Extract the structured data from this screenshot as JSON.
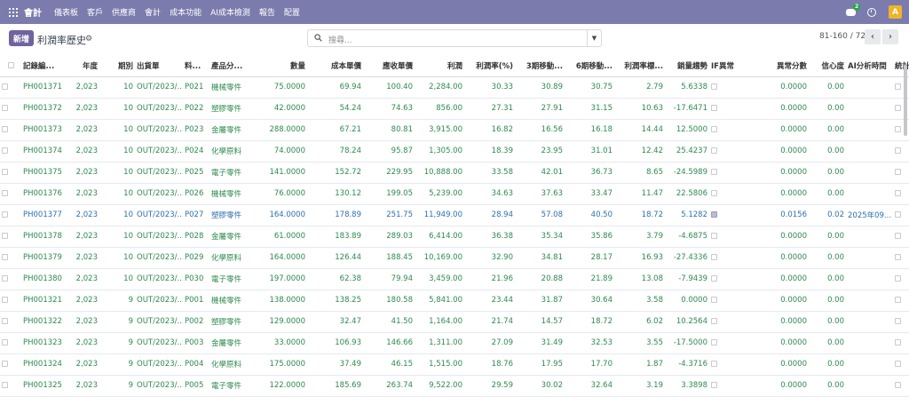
{
  "navbar": {
    "brand": "會計",
    "menu": [
      "儀表板",
      "客戶",
      "供應商",
      "會計",
      "成本功能",
      "AI成本檢測",
      "報告",
      "配置"
    ],
    "chat_badge": "2",
    "avatar_letter": "A"
  },
  "control": {
    "new_label": "新增",
    "title": "利潤率歷史",
    "search_placeholder": "搜尋...",
    "pager_value": "81-160 / 720",
    "prev_label": "‹",
    "next_label": "›"
  },
  "table": {
    "headers": [
      "記錄編...",
      "年度",
      "期別",
      "出貨單",
      "料...",
      "產品分...",
      "數量",
      "成本單價",
      "應收單價",
      "利潤",
      "利潤率(%)",
      "3期移動...",
      "6期移動...",
      "利潤率標...",
      "銷量趨勢",
      "IF異常",
      "異常分數",
      "信心度",
      "AI分析時間",
      "統計"
    ],
    "rows": [
      {
        "id": "PH001371",
        "year": "2,023",
        "period": "10",
        "shipment": "OUT/2023/...",
        "material": "P021",
        "category": "機械零件",
        "qty": "75.0000",
        "cost": "69.94",
        "price": "100.40",
        "profit": "2,284.00",
        "margin": "30.33",
        "ma3": "30.89",
        "ma6": "30.75",
        "std": "2.79",
        "trend": "5.6338",
        "anomaly_score": "0.0000",
        "confidence": "0.00",
        "ai_time": ""
      },
      {
        "id": "PH001372",
        "year": "2,023",
        "period": "10",
        "shipment": "OUT/2023/...",
        "material": "P022",
        "category": "塑膠零件",
        "qty": "42.0000",
        "cost": "54.24",
        "price": "74.63",
        "profit": "856.00",
        "margin": "27.31",
        "ma3": "27.91",
        "ma6": "31.15",
        "std": "10.63",
        "trend": "-17.6471",
        "anomaly_score": "0.0000",
        "confidence": "0.00",
        "ai_time": ""
      },
      {
        "id": "PH001373",
        "year": "2,023",
        "period": "10",
        "shipment": "OUT/2023/...",
        "material": "P023",
        "category": "金屬零件",
        "qty": "288.0000",
        "cost": "67.21",
        "price": "80.81",
        "profit": "3,915.00",
        "margin": "16.82",
        "ma3": "16.56",
        "ma6": "16.18",
        "std": "14.44",
        "trend": "12.5000",
        "anomaly_score": "0.0000",
        "confidence": "0.00",
        "ai_time": ""
      },
      {
        "id": "PH001374",
        "year": "2,023",
        "period": "10",
        "shipment": "OUT/2023/...",
        "material": "P024",
        "category": "化學原料",
        "qty": "74.0000",
        "cost": "78.24",
        "price": "95.87",
        "profit": "1,305.00",
        "margin": "18.39",
        "ma3": "23.95",
        "ma6": "31.01",
        "std": "12.42",
        "trend": "25.4237",
        "anomaly_score": "0.0000",
        "confidence": "0.00",
        "ai_time": ""
      },
      {
        "id": "PH001375",
        "year": "2,023",
        "period": "10",
        "shipment": "OUT/2023/...",
        "material": "P025",
        "category": "電子零件",
        "qty": "141.0000",
        "cost": "152.72",
        "price": "229.95",
        "profit": "10,888.00",
        "margin": "33.58",
        "ma3": "42.01",
        "ma6": "36.73",
        "std": "8.65",
        "trend": "-24.5989",
        "anomaly_score": "0.0000",
        "confidence": "0.00",
        "ai_time": ""
      },
      {
        "id": "PH001376",
        "year": "2,023",
        "period": "10",
        "shipment": "OUT/2023/...",
        "material": "P026",
        "category": "機械零件",
        "qty": "76.0000",
        "cost": "130.12",
        "price": "199.05",
        "profit": "5,239.00",
        "margin": "34.63",
        "ma3": "37.63",
        "ma6": "33.47",
        "std": "11.47",
        "trend": "22.5806",
        "anomaly_score": "0.0000",
        "confidence": "0.00",
        "ai_time": ""
      },
      {
        "id": "PH001377",
        "year": "2,023",
        "period": "10",
        "shipment": "OUT/2023/...",
        "material": "P027",
        "category": "塑膠零件",
        "qty": "164.0000",
        "cost": "178.89",
        "price": "251.75",
        "profit": "11,949.00",
        "margin": "28.94",
        "ma3": "57.08",
        "ma6": "40.50",
        "std": "18.72",
        "trend": "5.1282",
        "anomaly_score": "0.0156",
        "confidence": "0.02",
        "ai_time": "2025年09...",
        "selected": true
      },
      {
        "id": "PH001378",
        "year": "2,023",
        "period": "10",
        "shipment": "OUT/2023/...",
        "material": "P028",
        "category": "金屬零件",
        "qty": "61.0000",
        "cost": "183.89",
        "price": "289.03",
        "profit": "6,414.00",
        "margin": "36.38",
        "ma3": "35.34",
        "ma6": "35.86",
        "std": "3.79",
        "trend": "-4.6875",
        "anomaly_score": "0.0000",
        "confidence": "0.00",
        "ai_time": ""
      },
      {
        "id": "PH001379",
        "year": "2,023",
        "period": "10",
        "shipment": "OUT/2023/...",
        "material": "P029",
        "category": "化學原料",
        "qty": "164.0000",
        "cost": "126.44",
        "price": "188.45",
        "profit": "10,169.00",
        "margin": "32.90",
        "ma3": "34.81",
        "ma6": "28.17",
        "std": "16.93",
        "trend": "-27.4336",
        "anomaly_score": "0.0000",
        "confidence": "0.00",
        "ai_time": ""
      },
      {
        "id": "PH001380",
        "year": "2,023",
        "period": "10",
        "shipment": "OUT/2023/...",
        "material": "P030",
        "category": "電子零件",
        "qty": "197.0000",
        "cost": "62.38",
        "price": "79.94",
        "profit": "3,459.00",
        "margin": "21.96",
        "ma3": "20.88",
        "ma6": "21.89",
        "std": "13.08",
        "trend": "-7.9439",
        "anomaly_score": "0.0000",
        "confidence": "0.00",
        "ai_time": ""
      },
      {
        "id": "PH001321",
        "year": "2,023",
        "period": "9",
        "shipment": "OUT/2023/...",
        "material": "P001",
        "category": "機械零件",
        "qty": "138.0000",
        "cost": "138.25",
        "price": "180.58",
        "profit": "5,841.00",
        "margin": "23.44",
        "ma3": "31.87",
        "ma6": "30.64",
        "std": "3.58",
        "trend": "0.0000",
        "anomaly_score": "0.0000",
        "confidence": "0.00",
        "ai_time": ""
      },
      {
        "id": "PH001322",
        "year": "2,023",
        "period": "9",
        "shipment": "OUT/2023/...",
        "material": "P002",
        "category": "塑膠零件",
        "qty": "129.0000",
        "cost": "32.47",
        "price": "41.50",
        "profit": "1,164.00",
        "margin": "21.74",
        "ma3": "14.57",
        "ma6": "18.72",
        "std": "6.02",
        "trend": "10.2564",
        "anomaly_score": "0.0000",
        "confidence": "0.00",
        "ai_time": ""
      },
      {
        "id": "PH001323",
        "year": "2,023",
        "period": "9",
        "shipment": "OUT/2023/...",
        "material": "P003",
        "category": "金屬零件",
        "qty": "33.0000",
        "cost": "106.93",
        "price": "146.66",
        "profit": "1,311.00",
        "margin": "27.09",
        "ma3": "31.49",
        "ma6": "32.53",
        "std": "3.55",
        "trend": "-17.5000",
        "anomaly_score": "0.0000",
        "confidence": "0.00",
        "ai_time": ""
      },
      {
        "id": "PH001324",
        "year": "2,023",
        "period": "9",
        "shipment": "OUT/2023/...",
        "material": "P004",
        "category": "化學原料",
        "qty": "175.0000",
        "cost": "37.49",
        "price": "46.15",
        "profit": "1,515.00",
        "margin": "18.76",
        "ma3": "17.95",
        "ma6": "17.70",
        "std": "1.87",
        "trend": "-4.3716",
        "anomaly_score": "0.0000",
        "confidence": "0.00",
        "ai_time": ""
      },
      {
        "id": "PH001325",
        "year": "2,023",
        "period": "9",
        "shipment": "OUT/2023/...",
        "material": "P005",
        "category": "電子零件",
        "qty": "122.0000",
        "cost": "185.69",
        "price": "263.74",
        "profit": "9,522.00",
        "margin": "29.59",
        "ma3": "30.02",
        "ma6": "32.64",
        "std": "3.19",
        "trend": "3.3898",
        "anomaly_score": "0.0000",
        "confidence": "0.00",
        "ai_time": ""
      }
    ]
  }
}
